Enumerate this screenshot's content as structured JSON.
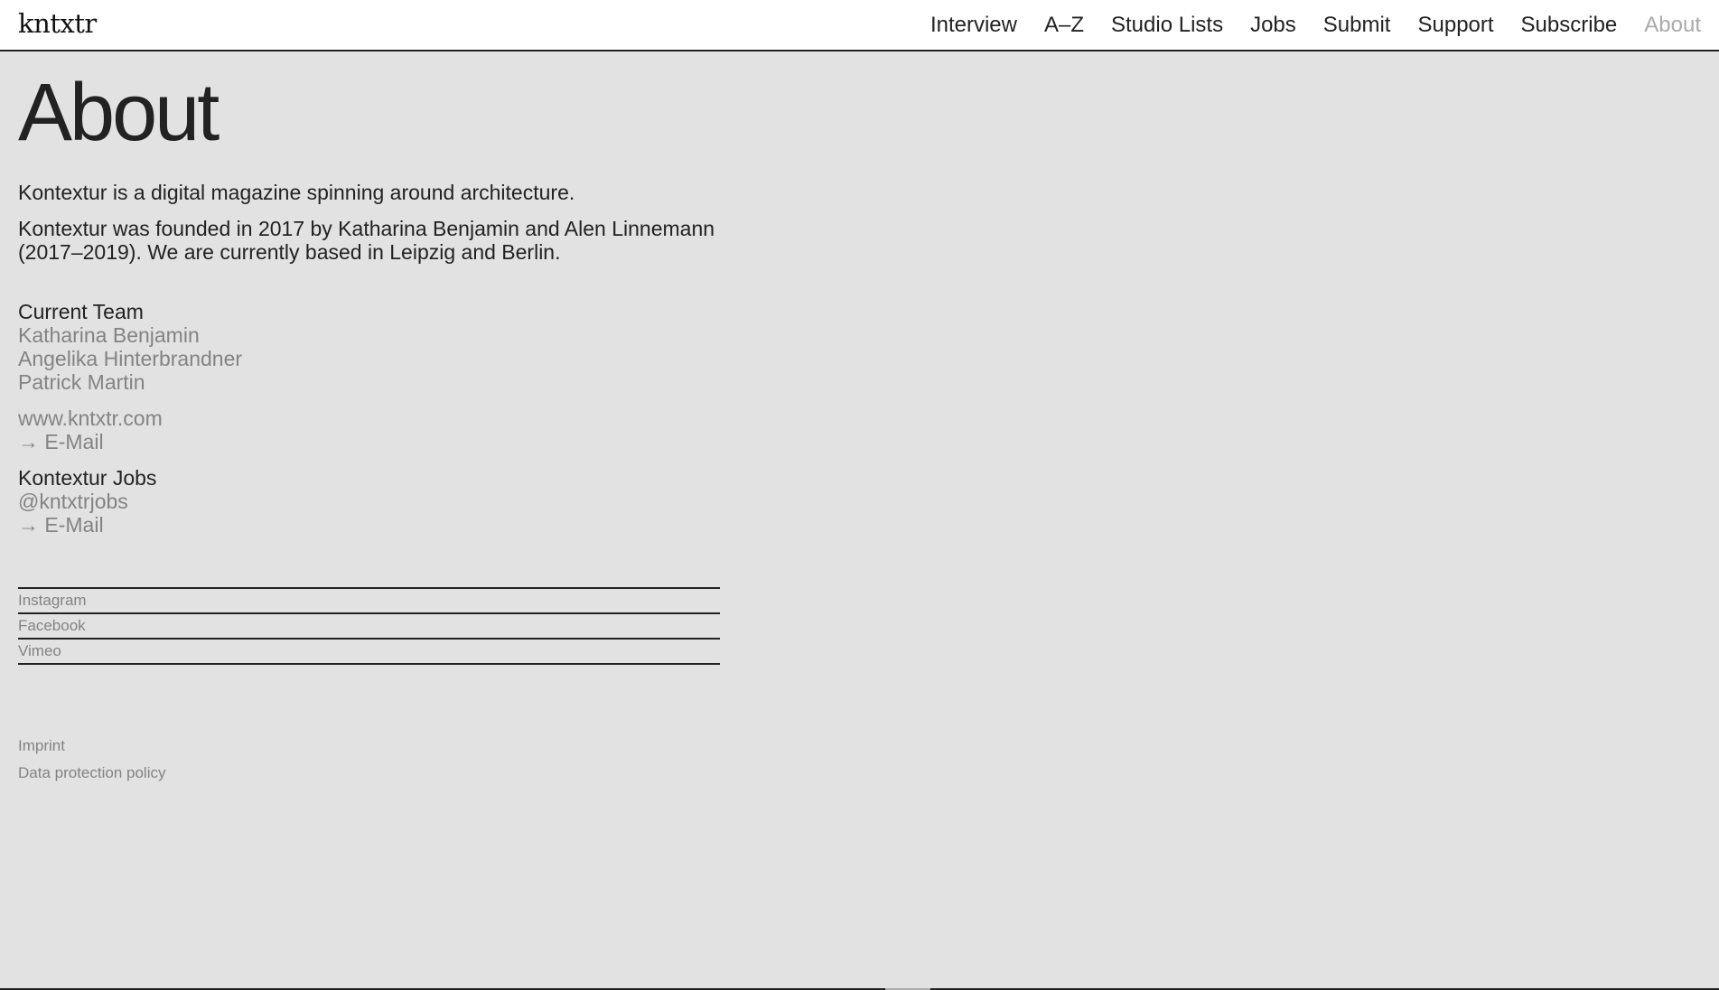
{
  "header": {
    "logo": "kntxtr",
    "nav": [
      {
        "label": "Interview"
      },
      {
        "label": "A–Z"
      },
      {
        "label": "Studio Lists"
      },
      {
        "label": "Jobs"
      },
      {
        "label": "Submit"
      },
      {
        "label": "Support"
      },
      {
        "label": "Subscribe"
      },
      {
        "label": "About"
      }
    ]
  },
  "main": {
    "title": "About",
    "intro": [
      "Kontextur is a digital magazine spinning around architecture.",
      "Kontextur was founded in 2017 by Katharina Benjamin and Alen Linnemann (2017–2019). We are currently based in Leipzig and Berlin."
    ],
    "team": {
      "heading": "Current Team",
      "members": [
        "Katharina Benjamin",
        "Angelika Hinterbrandner",
        "Patrick Martin"
      ]
    },
    "contact": {
      "website": "www.kntxtr.com",
      "email": "→ E-Mail"
    },
    "jobs": {
      "heading": "Kontextur Jobs",
      "handle": "@kntxtrjobs",
      "email": "→ E-Mail"
    },
    "social": [
      "Instagram",
      "Facebook",
      "Vimeo"
    ],
    "legal": [
      "Imprint",
      "Data protection policy"
    ]
  },
  "colors": {
    "background": "#e2e2e2",
    "header_bg": "#ffffff",
    "text": "#222222",
    "muted": "#838383",
    "nav_current": "#aaaaaa"
  }
}
